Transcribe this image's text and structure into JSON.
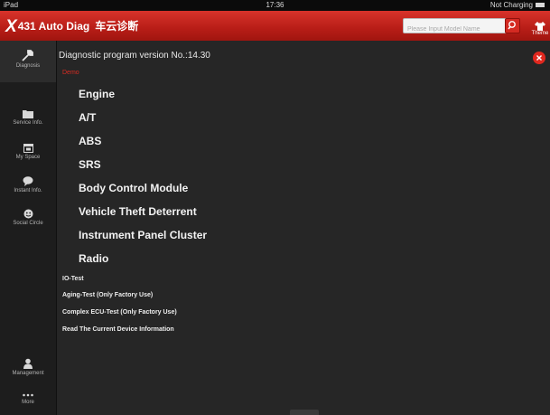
{
  "status_bar": {
    "carrier": "iPad",
    "time": "17:36",
    "charging": "Not Charging"
  },
  "app": {
    "logo_main": "431 Auto Diag",
    "logo_x": "X",
    "logo_cn": "车云诊断",
    "search_placeholder": "Please Input Model Name",
    "theme_label": "Theme"
  },
  "sidebar": {
    "items": [
      {
        "label": "Diagnosis"
      },
      {
        "label": "Service Info."
      },
      {
        "label": "My Space"
      },
      {
        "label": "Instant Info."
      },
      {
        "label": "Social Circle"
      },
      {
        "label": "Management"
      },
      {
        "label": "More"
      }
    ]
  },
  "main": {
    "version": "Diagnostic program version No.:14.30",
    "demo": "Demo",
    "systems": [
      "Engine",
      "A/T",
      "ABS",
      "SRS",
      "Body Control Module",
      "Vehicle Theft Deterrent",
      "Instrument Panel Cluster",
      "Radio"
    ],
    "tests": [
      "IO-Test",
      "Aging-Test (Only Factory Use)",
      "Complex ECU-Test (Only Factory Use)",
      "Read The Current Device Information"
    ]
  },
  "colors": {
    "accent": "#d32a22",
    "background": "#262626",
    "sidebar": "#1d1d1d",
    "text": "#f2f2f2"
  }
}
